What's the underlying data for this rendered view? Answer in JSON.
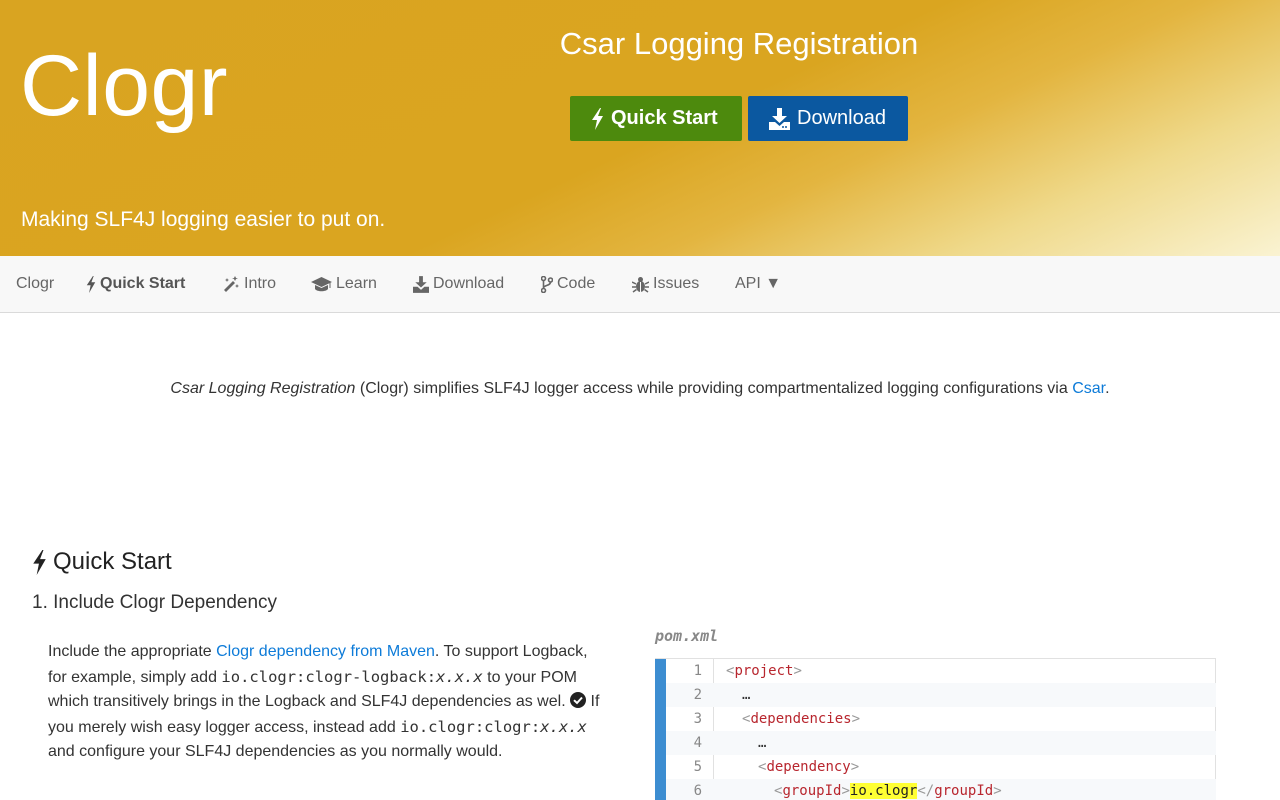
{
  "hero": {
    "logo": "Clogr",
    "title": "Csar Logging Registration",
    "tagline": "Making SLF4J logging easier to put on.",
    "buttons": {
      "quick_start": "Quick Start",
      "download": "Download"
    }
  },
  "navbar": {
    "brand": "Clogr",
    "items": [
      {
        "label": "Quick Start",
        "icon": "bolt-icon",
        "active": true
      },
      {
        "label": "Intro",
        "icon": "magic-wand-icon"
      },
      {
        "label": "Learn",
        "icon": "graduation-cap-icon"
      },
      {
        "label": "Download",
        "icon": "download-icon"
      },
      {
        "label": "Code",
        "icon": "code-branch-icon"
      },
      {
        "label": "Issues",
        "icon": "bug-icon"
      },
      {
        "label": "API ▼",
        "icon": ""
      }
    ]
  },
  "intro": {
    "project_name": "Csar Logging Registration",
    "text": " (Clogr) simplifies SLF4J logger access while providing compartmentalized logging configurations via ",
    "link": "Csar",
    "end": "."
  },
  "quick_start": {
    "heading": "Quick Start",
    "step1_title": "1. Include Clogr Dependency",
    "para": {
      "t1": "Include the appropriate ",
      "link": "Clogr dependency from Maven",
      "t2": ". To support Logback, for example, simply add ",
      "code1": "io.clogr:clogr-logback:",
      "code1_ver": "x.x.x",
      "t3": " to your POM which transitively brings in the Logback and SLF4J dependencies as wel. ",
      "t4": " If you merely wish easy logger access, instead add ",
      "code2": "io.clogr:clogr:",
      "code2_ver": "x.x.x",
      "t5": " and configure your SLF4J dependencies as you normally would."
    }
  },
  "code": {
    "filename": "pom.xml",
    "lines": [
      {
        "n": "1",
        "indent": 0,
        "tag": "project"
      },
      {
        "n": "2",
        "indent": 1,
        "text": "…"
      },
      {
        "n": "3",
        "indent": 1,
        "tag": "dependencies"
      },
      {
        "n": "4",
        "indent": 2,
        "text": "…"
      },
      {
        "n": "5",
        "indent": 2,
        "tag": "dependency"
      },
      {
        "n": "6",
        "indent": 3,
        "tag": "groupId",
        "value": "io.clogr"
      }
    ]
  },
  "colors": {
    "hero_gold": "#daa520",
    "quick_start_green": "#4d8a0d",
    "download_blue": "#0b58a0",
    "link_blue": "#0d7bd8",
    "code_bar_blue": "#3c8dd1",
    "tag_red": "#b8262e",
    "highlight_yellow": "#ffff33"
  }
}
